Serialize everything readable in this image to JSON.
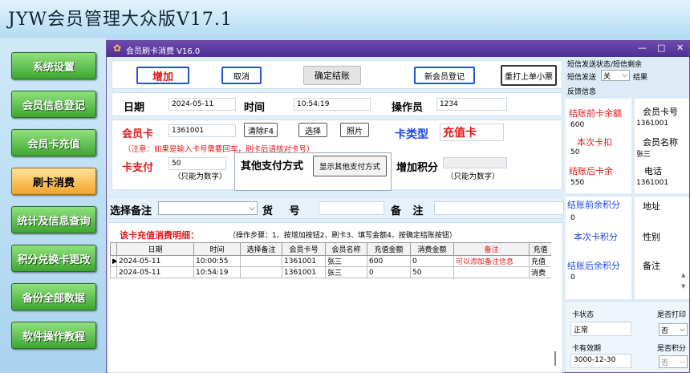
{
  "app": {
    "title": "JYW会员管理大众版V17.1"
  },
  "sidebar": {
    "items": [
      {
        "label": "系统设置",
        "active": false
      },
      {
        "label": "会员信息登记",
        "active": false
      },
      {
        "label": "会员卡充值",
        "active": false
      },
      {
        "label": "刷卡消费",
        "active": true
      },
      {
        "label": "统计及信息查询",
        "active": false
      },
      {
        "label": "积分兑换卡更改",
        "active": false
      },
      {
        "label": "备份全部数据",
        "active": false
      },
      {
        "label": "软件操作教程",
        "active": false
      }
    ]
  },
  "window": {
    "title": "会员刷卡消费 V16.0",
    "min": "—",
    "max": "□",
    "close": "✕"
  },
  "toolbar": {
    "add": "增加",
    "cancel": "取消",
    "confirm": "确定结账",
    "new_member": "新会员登记",
    "reprint": "重打上单小票"
  },
  "info": {
    "date_label": "日期",
    "date": "2024-05-11",
    "time_label": "时间",
    "time": "10:54:19",
    "operator_label": "操作员",
    "operator": "1234"
  },
  "card": {
    "label": "会员卡",
    "value": "1361001",
    "clear": "清除F4",
    "choose": "选择",
    "photo": "照片",
    "type_label": "卡类型",
    "type_value": "充值卡",
    "note": "（注意：如果是输入卡号需要回车，刷卡后请核对卡号）"
  },
  "pay": {
    "label": "卡支付",
    "value": "50",
    "hint": "（只能为数字）",
    "other_label": "其他支付方式",
    "show_other": "显示其他支付方式",
    "points_label": "增加积分",
    "points_hint": "（只能为数字）"
  },
  "remark_row": {
    "select_label": "选择备注",
    "goods_label": "货 号",
    "remark_label": "备 注"
  },
  "detail": {
    "title": "该卡充值消费明细：",
    "steps": "（操作步骤：1、按增加按钮2、刷卡3、填写金额4、按确定结账按钮）",
    "columns": [
      "日期",
      "时间",
      "选择备注",
      "会员卡号",
      "会员名称",
      "充值金额",
      "消费金额",
      "备注",
      "充值"
    ],
    "rows": [
      [
        "2024-05-11",
        "10:00:55",
        "",
        "1361001",
        "张三",
        "600",
        "0",
        "可以添加备注信息",
        "充值"
      ],
      [
        "2024-05-11",
        "10:54:19",
        "",
        "1361001",
        "张三",
        "0",
        "50",
        "",
        "消费"
      ]
    ]
  },
  "sms": {
    "header": "短信发送状态/短信剩余",
    "send_label": "短信发送",
    "send_value": "关",
    "result": "结果",
    "feedback": "反馈信息"
  },
  "balance": {
    "before_label": "结账前卡余额",
    "before": "600",
    "deduct_label": "本次卡扣",
    "deduct": "50",
    "after_label": "结账后卡余",
    "after": "550",
    "pts_before_label": "结账前余积分",
    "pts_before": "0",
    "pts_now_label": "本次卡积分",
    "pts_after_label": "结账后余积分",
    "pts_after": "0"
  },
  "member": {
    "card_no_label": "会员卡号",
    "card_no": "1361001",
    "name_label": "会员名称",
    "name": "张三",
    "phone_label": "电话",
    "phone": "1361001",
    "address_label": "地址",
    "gender_label": "性别",
    "remark_label": "备注"
  },
  "status": {
    "state_label": "卡状态",
    "state": "正常",
    "print_label": "是否打印",
    "print_value": "否",
    "expiry_label": "卡有效期",
    "expiry": "3000-12-30",
    "points_label": "是否积分",
    "points_value": "否"
  }
}
